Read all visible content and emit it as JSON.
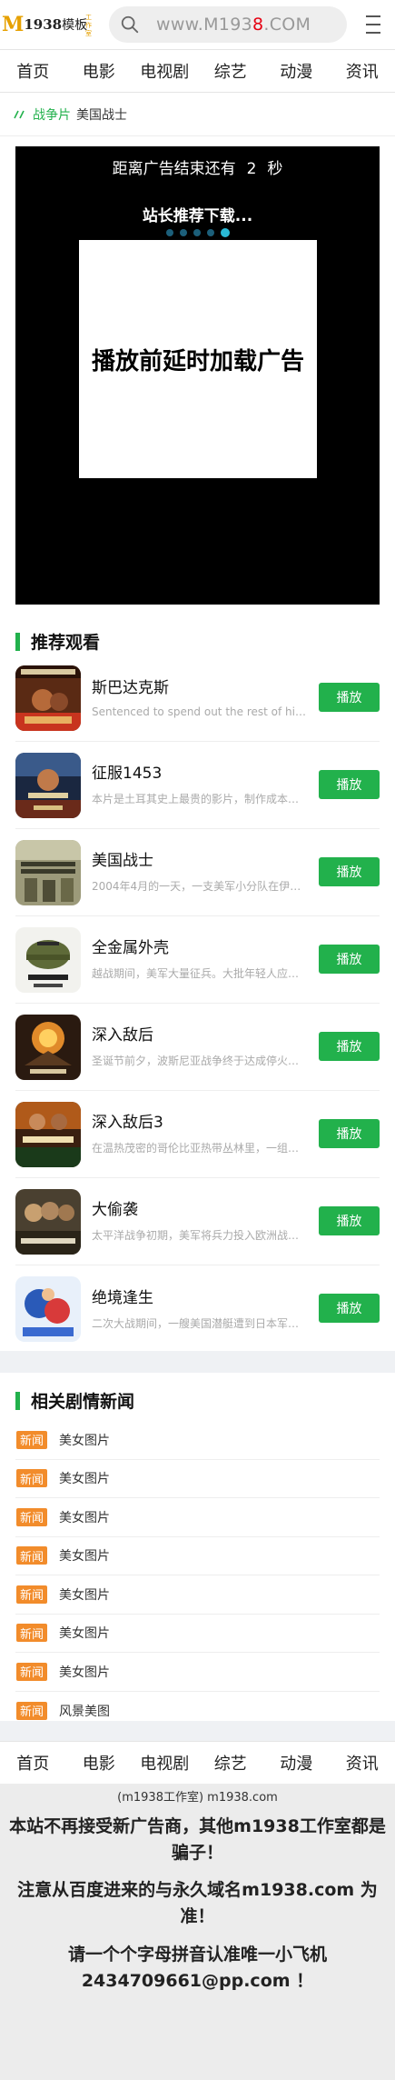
{
  "header": {
    "logo_m": "M",
    "logo_text": "1938",
    "logo_cn": "模板",
    "logo_sub": "工作室",
    "search_prefix": "www.M193",
    "search_red": "8",
    "search_suffix": ".COM"
  },
  "nav": [
    "首页",
    "电影",
    "电视剧",
    "综艺",
    "动漫",
    "资讯"
  ],
  "breadcrumb": {
    "category": "战争片",
    "title": "美国战士"
  },
  "player": {
    "ad_timer_prefix": "距离广告结束还有",
    "ad_timer_seconds": "2",
    "ad_timer_unit": "秒",
    "ad_recommend": "站长推荐下载...",
    "ad_box_text": "播放前延时加载广告",
    "carousel_active_index": 4,
    "carousel_count": 5
  },
  "recommend": {
    "title": "推荐观看",
    "play_label": "播放",
    "items": [
      {
        "name": "斯巴达克斯",
        "desc": "Sentenced to spend out the rest of his a...",
        "poster": "poster-spartacus"
      },
      {
        "name": "征服1453",
        "desc": "本片是土耳其史上最贵的影片，制作成本达...",
        "poster": "poster-fetih-1453"
      },
      {
        "name": "美国战士",
        "desc": "2004年4月的一天，一支美军小分队在伊拉...",
        "poster": "poster-american-soldiers"
      },
      {
        "name": "全金属外壳",
        "desc": "越战期间，美军大量征兵。大批年轻人应征...",
        "poster": "poster-full-metal-jacket"
      },
      {
        "name": "深入敌后",
        "desc": "圣诞节前夕，波斯尼亚战争终于达成停火协...",
        "poster": "poster-behind-enemy-lines"
      },
      {
        "name": "深入敌后3",
        "desc": "在温热茂密的哥伦比亚热带丛林里，一组秘...",
        "poster": "poster-behind-enemy-lines-3"
      },
      {
        "name": "大偷袭",
        "desc": "太平洋战争初期，美军将兵力投入欧洲战场...",
        "poster": "poster-la-grande-attaque"
      },
      {
        "name": "绝境逢生",
        "desc": "二次大战期间，一艘美国潜艇遭到日本军舰...",
        "poster": "poster-cartoon"
      }
    ]
  },
  "news": {
    "title": "相关剧情新闻",
    "tag": "新闻",
    "items": [
      "美女图片",
      "美女图片",
      "美女图片",
      "美女图片",
      "美女图片",
      "美女图片",
      "美女图片",
      "风景美图"
    ]
  },
  "footer": {
    "nav": [
      "首页",
      "电影",
      "电视剧",
      "综艺",
      "动漫",
      "资讯"
    ],
    "copyright": "(m1938工作室) m1938.com",
    "line1": "本站不再接受新广告商，其他m1938工作室都是骗子！",
    "line2": "注意从百度进来的与永久域名m1938.com 为准！",
    "line3": "请一个个字母拼音认准唯一小飞机 2434709661@pp.com ！"
  },
  "colors": {
    "accent": "#22b14c",
    "news_tag": "#f28c2b",
    "logo": "#e6a000",
    "domain_highlight": "#e60012"
  }
}
